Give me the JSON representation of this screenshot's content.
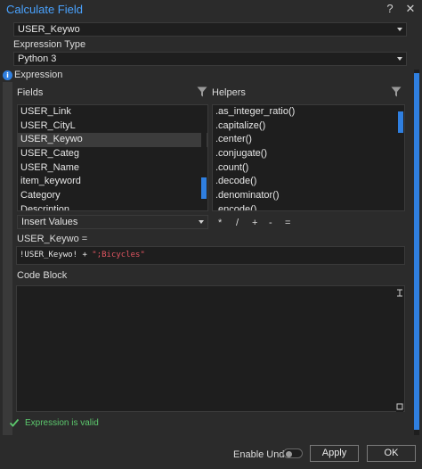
{
  "window": {
    "title": "Calculate Field",
    "help_glyph": "?",
    "close_glyph": "✕"
  },
  "field_select": {
    "value": "USER_Keywo"
  },
  "expression_type": {
    "label": "Expression Type",
    "value": "Python 3"
  },
  "expression_section": {
    "label": "Expression"
  },
  "fields": {
    "label": "Fields",
    "items": [
      "USER_Link",
      "USER_CityL",
      "USER_Keywo",
      "USER_Categ",
      "USER_Name",
      "item_keyword",
      "Category",
      "Description"
    ],
    "selected_index": 2
  },
  "helpers": {
    "label": "Helpers",
    "items": [
      ".as_integer_ratio()",
      ".capitalize()",
      ".center()",
      ".conjugate()",
      ".count()",
      ".decode()",
      ".denominator()",
      ".encode()"
    ]
  },
  "insert_values": {
    "value": "Insert Values"
  },
  "operators": [
    "*",
    "/",
    "+",
    "-",
    "="
  ],
  "expression": {
    "label": "USER_Keywo =",
    "field_part": "!USER_Keywo! + ",
    "string_part": "\";Bicycles\""
  },
  "code_block": {
    "label": "Code Block"
  },
  "validation": {
    "text": "Expression is valid"
  },
  "footer": {
    "enable_undo_label": "Enable Undo",
    "apply_label": "Apply",
    "ok_label": "OK"
  },
  "colors": {
    "accent": "#2f7fe0",
    "title": "#4aa3ff",
    "valid": "#5cc86d",
    "string": "#e05561"
  },
  "icons": [
    "help-icon",
    "close-icon",
    "info-icon",
    "filter-icon",
    "check-icon",
    "chevron-down-icon",
    "pin-icon"
  ]
}
